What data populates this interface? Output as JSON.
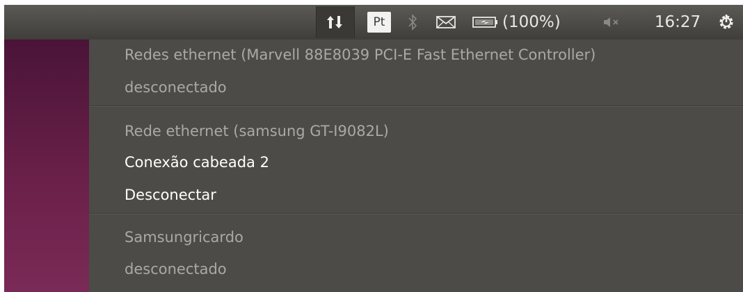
{
  "panel": {
    "keyboard_layout": "Pt",
    "battery_percent_label": "(100%)",
    "clock": "16:27",
    "icons": {
      "network": "network-up-down-icon",
      "bluetooth": "bluetooth-icon",
      "mail": "envelope-icon",
      "battery": "battery-charging-icon",
      "sound": "sound-muted-icon",
      "session": "gear-power-icon"
    }
  },
  "menu": {
    "sections": [
      {
        "header": "Redes ethernet (Marvell 88E8039 PCI-E Fast Ethernet Controller)",
        "status": "desconectado"
      },
      {
        "header": "Rede ethernet (samsung GT-I9082L)",
        "connection": "Conexão cabeada 2",
        "action": "Desconectar"
      },
      {
        "header": "Samsungricardo",
        "status": "desconectado"
      }
    ]
  },
  "colors": {
    "panel": "#4a4945",
    "menu_bg": "#4c4b47",
    "text_dim": "#a9a9a5",
    "text_active": "#ffffff",
    "desktop": "#6a2049"
  }
}
